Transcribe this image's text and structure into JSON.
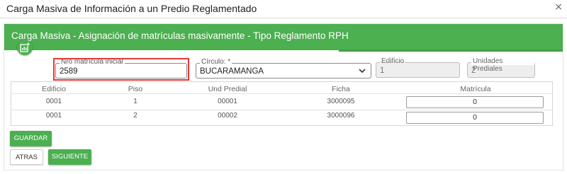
{
  "dialog": {
    "title": "Carga Masiva de Información a un Predio Reglamentado",
    "close_glyph": "×"
  },
  "panel": {
    "header": "Carga Masiva - Asignación de matrículas masivamente - Tipo Reglamento RPH"
  },
  "form": {
    "nro_matricula": {
      "label": "Nro matrícula inicial",
      "value": "2589"
    },
    "circulo": {
      "label": "Círculo:",
      "required_mark": "*",
      "value": "BUCARAMANGA"
    },
    "edificio": {
      "label": "Edificio",
      "value": "1"
    },
    "unidades": {
      "label": "Unidades Prediales",
      "value": "2"
    }
  },
  "table": {
    "columns": [
      "Edificio",
      "Piso",
      "Und Predial",
      "Ficha",
      "Matrícula"
    ],
    "rows": [
      {
        "edificio": "0001",
        "piso": "1",
        "und_predial": "00001",
        "ficha": "3000095",
        "matricula": "0"
      },
      {
        "edificio": "0001",
        "piso": "2",
        "und_predial": "00002",
        "ficha": "3000096",
        "matricula": "0"
      }
    ]
  },
  "buttons": {
    "guardar": "GUARDAR",
    "atras": "ATRAS",
    "siguiente": "SIGUIENTE"
  },
  "colors": {
    "accent": "#4caf50",
    "highlight": "#e53935"
  },
  "icons": {
    "add_chart": "chart-add-icon",
    "close": "close-icon",
    "select": "chevron-down-icon"
  }
}
